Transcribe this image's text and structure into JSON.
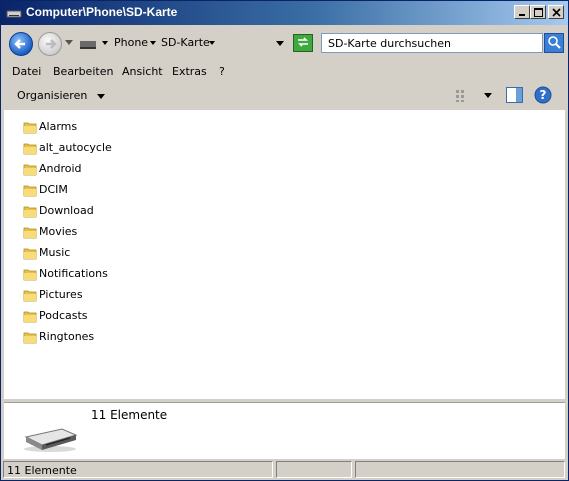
{
  "window": {
    "title": "Computer\\Phone\\SD-Karte"
  },
  "address": {
    "crumbs": [
      "Phone",
      "SD-Karte"
    ]
  },
  "search": {
    "placeholder": "SD-Karte durchsuchen"
  },
  "menu": [
    "Datei",
    "Bearbeiten",
    "Ansicht",
    "Extras",
    "?"
  ],
  "toolbar": {
    "organize_label": "Organisieren"
  },
  "folders": [
    "Alarms",
    "alt_autocycle",
    "Android",
    "DCIM",
    "Download",
    "Movies",
    "Music",
    "Notifications",
    "Pictures",
    "Podcasts",
    "Ringtones"
  ],
  "details": {
    "count_text": "11 Elemente"
  },
  "status": {
    "count_text": "11 Elemente"
  },
  "icons": {
    "title": "removable-drive-icon",
    "back": "back-arrow-icon",
    "forward": "forward-arrow-icon",
    "refresh": "refresh-icon",
    "search": "search-icon",
    "views": "view-options-icon",
    "preview": "preview-pane-icon",
    "help": "help-icon",
    "folder": "folder-icon"
  },
  "colors": {
    "title_bar": "#0a246a",
    "folder": "#f5d66b",
    "accent": "#3a7fd6"
  }
}
